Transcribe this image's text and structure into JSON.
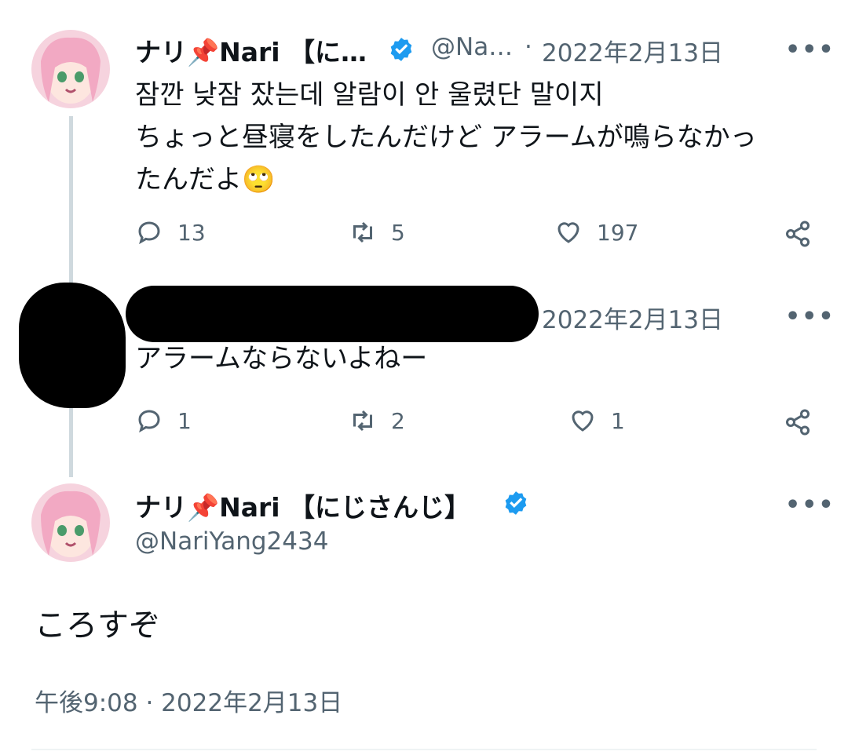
{
  "tweet1": {
    "display_name": "ナリ📌Nari 【に…",
    "handle": "@Na…",
    "separator": "·",
    "date": "2022年2月13日",
    "text_line1": "잠깐 낮잠 잤는데 알람이 안 울렸단 말이지",
    "text_line2": "ちょっと昼寝をしたんだけど アラームが鳴らなかっ",
    "text_line3": "たんだよ",
    "emoji": "🙄",
    "replies": "13",
    "retweets": "5",
    "likes": "197"
  },
  "reply": {
    "date": "2022年2月13日",
    "text": "アラームならないよねー",
    "replies": "1",
    "retweets": "2",
    "likes": "1"
  },
  "tweet_main": {
    "display_name": "ナリ📌Nari 【にじさんじ】",
    "handle": "@NariYang2434",
    "text": "ころすぞ",
    "timestamp": "午後9:08 · 2022年2月13日"
  },
  "more_label": "•••",
  "colors": {
    "verified": "#1d9bf0",
    "secondary_text": "#536471",
    "primary_text": "#0f1419"
  }
}
